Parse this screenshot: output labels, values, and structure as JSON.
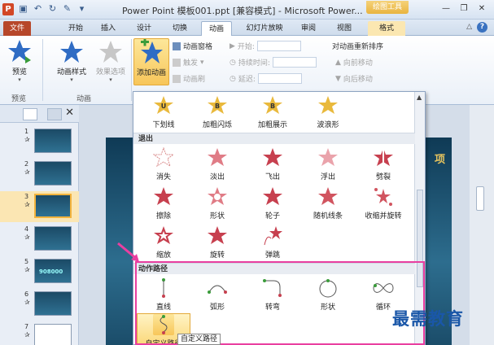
{
  "titlebar": {
    "logo": "P",
    "title": "Power Point  模板001.ppt [兼容模式] - Microsoft Power...",
    "tool_context": "绘图工具"
  },
  "tabs": [
    {
      "label": "文件"
    },
    {
      "label": "开始"
    },
    {
      "label": "插入"
    },
    {
      "label": "设计"
    },
    {
      "label": "切换"
    },
    {
      "label": "动画"
    },
    {
      "label": "幻灯片放映"
    },
    {
      "label": "审阅"
    },
    {
      "label": "视图"
    },
    {
      "label": "格式"
    }
  ],
  "active_tab": "动画",
  "ribbon": {
    "preview": "预览",
    "anim_style": "动画样式",
    "effect_options": "效果选项",
    "add_animation": "添加动画",
    "anim_pane": "动画窗格",
    "trigger": "触发",
    "anim_painter": "动画刷",
    "start_label": "开始:",
    "duration_label": "持续时间:",
    "delay_label": "延迟:",
    "reorder_title": "对动画重新排序",
    "move_earlier": "向前移动",
    "move_later": "向后移动",
    "group_preview": "预览",
    "group_animation": "动画"
  },
  "slides": [
    {
      "num": "1",
      "thumb_text": ""
    },
    {
      "num": "2",
      "thumb_text": ""
    },
    {
      "num": "3",
      "thumb_text": ""
    },
    {
      "num": "4",
      "thumb_text": ""
    },
    {
      "num": "5",
      "thumb_text": "908000"
    },
    {
      "num": "6",
      "thumb_text": ""
    },
    {
      "num": "7",
      "thumb_text": ""
    }
  ],
  "slide_title": "项",
  "gallery": {
    "emphasis_row": [
      {
        "label": "下划线",
        "icon": "underline-star-icon"
      },
      {
        "label": "加粗闪烁",
        "icon": "bold-flash-star-icon"
      },
      {
        "label": "加粗展示",
        "icon": "bold-reveal-star-icon"
      },
      {
        "label": "波浪形",
        "icon": "wave-star-icon"
      }
    ],
    "exit_title": "退出",
    "exit_rows": [
      [
        {
          "label": "消失",
          "icon": "disappear-star-icon"
        },
        {
          "label": "淡出",
          "icon": "fade-star-icon"
        },
        {
          "label": "飞出",
          "icon": "fly-out-star-icon"
        },
        {
          "label": "浮出",
          "icon": "float-out-star-icon"
        },
        {
          "label": "劈裂",
          "icon": "split-star-icon"
        }
      ],
      [
        {
          "label": "擦除",
          "icon": "wipe-star-icon"
        },
        {
          "label": "形状",
          "icon": "shape-star-icon"
        },
        {
          "label": "轮子",
          "icon": "wheel-star-icon"
        },
        {
          "label": "随机线条",
          "icon": "random-bars-star-icon"
        },
        {
          "label": "收缩并旋转",
          "icon": "shrink-turn-star-icon"
        }
      ],
      [
        {
          "label": "缩放",
          "icon": "zoom-star-icon"
        },
        {
          "label": "旋转",
          "icon": "swivel-star-icon"
        },
        {
          "label": "弹跳",
          "icon": "bounce-star-icon"
        }
      ]
    ],
    "motion_title": "动作路径",
    "motion_rows": [
      [
        {
          "label": "直线",
          "icon": "line-path-icon"
        },
        {
          "label": "弧形",
          "icon": "arc-path-icon"
        },
        {
          "label": "转弯",
          "icon": "turn-path-icon"
        },
        {
          "label": "形状",
          "icon": "shape-path-icon"
        },
        {
          "label": "循环",
          "icon": "loop-path-icon"
        }
      ],
      [
        {
          "label": "自定义路径",
          "icon": "custom-path-icon"
        }
      ]
    ],
    "tooltip": "自定义路径"
  },
  "watermark": "最需教育"
}
